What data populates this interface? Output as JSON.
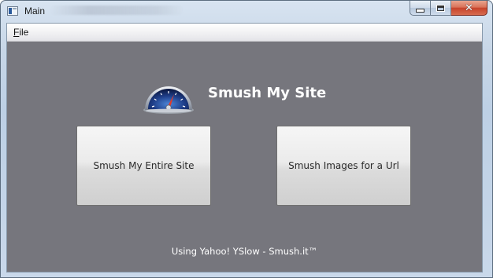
{
  "window": {
    "title": "Main",
    "close_glyph": "✕"
  },
  "menu": {
    "file_mnemonic": "F",
    "file_rest": "ile"
  },
  "main": {
    "heading": "Smush My Site",
    "logo_icon": "speedometer-icon",
    "buttons": [
      {
        "label": "Smush My Entire Site"
      },
      {
        "label": "Smush Images for a Url"
      }
    ],
    "footer": "Using Yahoo! YSlow - Smush.it™"
  },
  "colors": {
    "client_background": "#76767d",
    "heading_text": "#ffffff"
  }
}
